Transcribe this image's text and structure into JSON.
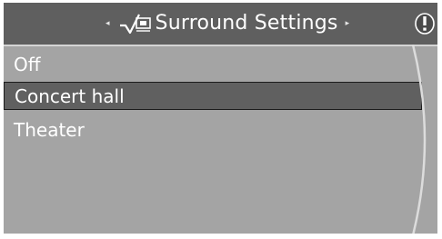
{
  "header": {
    "title": "Surround Settings",
    "prev_arrow": "◂",
    "next_arrow": "▸",
    "title_icon": "surround-settings-icon",
    "info_icon": "info-exclamation-icon"
  },
  "menu": {
    "items": [
      {
        "label": "Off",
        "selected": false
      },
      {
        "label": "Concert hall",
        "selected": true
      },
      {
        "label": "Theater",
        "selected": false
      }
    ]
  },
  "colors": {
    "header_bg": "#5f5f5f",
    "list_bg": "#a4a4a4",
    "selected_bg": "#606060",
    "text": "#ffffff"
  }
}
